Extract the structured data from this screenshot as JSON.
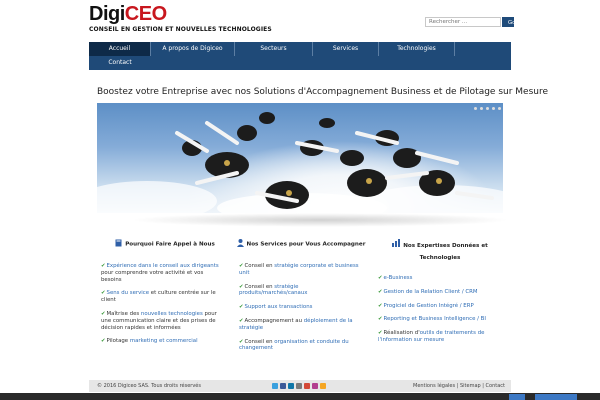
{
  "header": {
    "logo_part1": "Digi",
    "logo_part2": "CEO",
    "tagline": "CONSEIL EN GESTION ET NOUVELLES TECHNOLOGIES",
    "search_placeholder": "Rechercher ...",
    "search_button": "Go"
  },
  "nav": {
    "items": [
      {
        "label": "Accueil",
        "active": true
      },
      {
        "label": "A propos de Digiceo"
      },
      {
        "label": "Secteurs"
      },
      {
        "label": "Services"
      },
      {
        "label": "Technologies"
      },
      {
        "label": "Contact"
      }
    ]
  },
  "hero": {
    "title": "Boostez votre Entreprise avec nos Solutions d'Accompagnement Business et de Pilotage sur Mesure"
  },
  "columns": [
    {
      "title": "Pourquoi Faire Appel à Nous",
      "icon": "book-icon",
      "items": [
        [
          {
            "t": "Expérience dans le conseil aux dirigeants",
            "link": true
          },
          {
            "t": " pour comprendre votre activité et vos besoins"
          }
        ],
        [
          {
            "t": "Sens du service",
            "link": true
          },
          {
            "t": " et culture centrée sur le client"
          }
        ],
        [
          {
            "t": "Maîtrise des "
          },
          {
            "t": "nouvelles technologies",
            "link": true
          },
          {
            "t": " pour une communication claire et des prises de décision rapides et informées"
          }
        ],
        [
          {
            "t": "Pilotage "
          },
          {
            "t": "marketing et commercial",
            "link": true
          }
        ]
      ]
    },
    {
      "title": "Nos Services pour Vous Accompagner",
      "icon": "user-icon",
      "items": [
        [
          {
            "t": "Conseil en "
          },
          {
            "t": "stratégie corporate et business unit",
            "link": true
          }
        ],
        [
          {
            "t": "Conseil en "
          },
          {
            "t": "stratégie produits/marchés/canaux",
            "link": true
          }
        ],
        [
          {
            "t": "Support aux transactions",
            "link": true
          }
        ],
        [
          {
            "t": "Accompagnement au "
          },
          {
            "t": "déploiement de la stratégie",
            "link": true
          }
        ],
        [
          {
            "t": "Conseil en "
          },
          {
            "t": "organisation et conduite du changement",
            "link": true
          }
        ]
      ]
    },
    {
      "title": "Nos Expertises Données et Technologies",
      "icon": "bar-chart-icon",
      "items": [
        [
          {
            "t": "e-Business",
            "link": true
          }
        ],
        [
          {
            "t": "Gestion de la Relation Client / CRM",
            "link": true
          }
        ],
        [
          {
            "t": "Progiciel de Gestion Intégré / ERP",
            "link": true
          }
        ],
        [
          {
            "t": "Reporting et Business Intelligence / BI",
            "link": true
          }
        ],
        [
          {
            "t": "Réalisation d'"
          },
          {
            "t": "outils de traitements de l'information sur mesure",
            "link": true
          }
        ]
      ]
    }
  ],
  "footer": {
    "copyright": "© 2016 Digiceo SAS. Tous droits réservés",
    "links": "Mentions légales | Sitemap | Contact"
  },
  "colors": {
    "nav_bg": "#1f4a78",
    "nav_active": "#0e2a48",
    "link": "#2f6db5",
    "brand_red": "#c8171e"
  }
}
